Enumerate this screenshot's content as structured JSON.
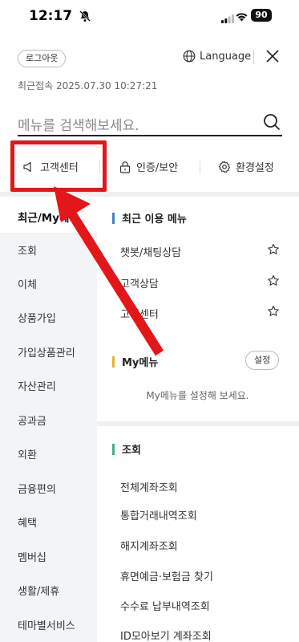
{
  "status": {
    "time": "12:17",
    "battery": "90"
  },
  "header": {
    "logout_label": "로그아웃",
    "language_label": "Language",
    "last_login": "최근접속 2025.07.30 10:27:21"
  },
  "search": {
    "placeholder": "메뉴를 검색해보세요."
  },
  "quick_menu": [
    {
      "label": "고객센터",
      "icon": "speaker-icon"
    },
    {
      "label": "인증/보안",
      "icon": "lock-icon"
    },
    {
      "label": "환경설정",
      "icon": "gear-icon"
    }
  ],
  "left_nav": {
    "active": "최근/My메뉴",
    "items": [
      "조회",
      "이체",
      "상품가입",
      "가입상품관리",
      "자산관리",
      "공과금",
      "외환",
      "금융편의",
      "혜택",
      "멤버십",
      "생활/제휴",
      "테마별서비스"
    ]
  },
  "recent": {
    "title": "최근 이용 메뉴",
    "items": [
      "챗봇/채팅상담",
      "고객상담",
      "고객센터"
    ]
  },
  "my_menu": {
    "title": "My메뉴",
    "settings_label": "설정",
    "empty_message": "My메뉴를 설정해 보세요."
  },
  "inquiry": {
    "title": "조회",
    "items": [
      "전체계좌조회",
      "통합거래내역조회",
      "해지계좌조회",
      "휴면예금·보험금 찾기",
      "수수료 납부내역조회",
      "ID모아보기 계좌조회"
    ]
  },
  "colors": {
    "highlight": "#e3161a",
    "recent_bar": "#3b82c4",
    "my_bar": "#e0b43a",
    "inquiry_bar": "#4aa88e"
  }
}
